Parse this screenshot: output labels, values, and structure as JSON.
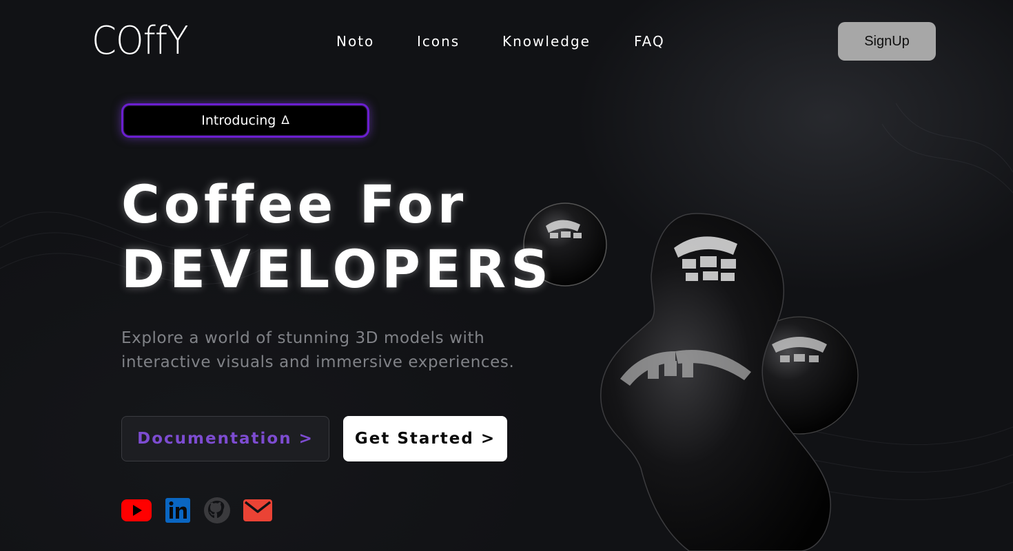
{
  "brand": {
    "logo": "COffY"
  },
  "nav": {
    "items": [
      "Noto",
      "Icons",
      "Knowledge",
      "FAQ"
    ],
    "signup_label": "SignUp"
  },
  "badge": {
    "label": "Introducing",
    "icon": "delta-icon",
    "glyph": "∆",
    "accent": "#6b1ed0"
  },
  "hero": {
    "title_line1": "Coffee For",
    "title_line2": "DEVELOPERS",
    "subtitle": "Explore a world of stunning 3D models with interactive visuals and immersive experiences."
  },
  "actions": {
    "documentation_label": "Documentation >",
    "get_started_label": "Get Started >",
    "documentation_color": "#7d4cd1"
  },
  "social": [
    {
      "name": "youtube-icon",
      "color": "#ff0000"
    },
    {
      "name": "linkedin-icon",
      "color": "#0a66c2"
    },
    {
      "name": "github-icon",
      "color": "#3a3a3d"
    },
    {
      "name": "mail-icon",
      "color": "#ea4335"
    }
  ],
  "colors": {
    "background": "#111215",
    "signup_bg": "#a7a7a7"
  }
}
